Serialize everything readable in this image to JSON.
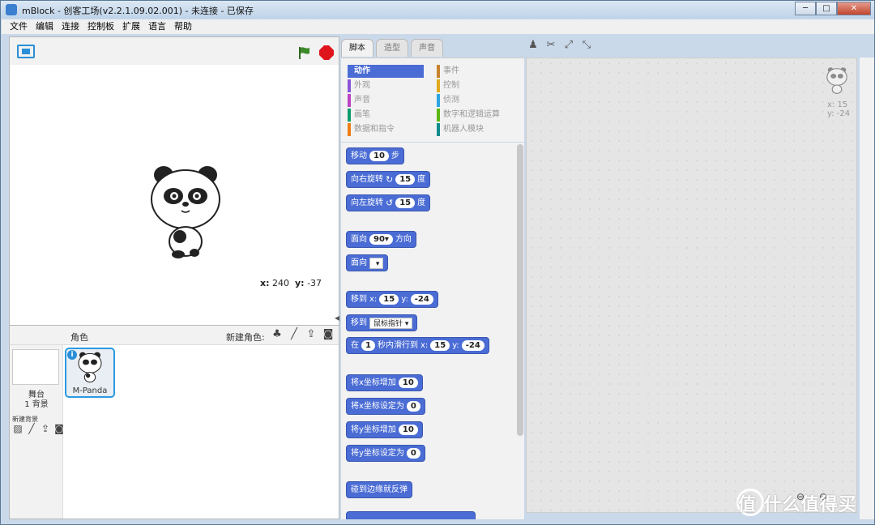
{
  "window": {
    "title": "mBlock - 创客工场(v2.2.1.09.02.001) - 未连接 - 已保存",
    "controls": [
      "─",
      "□",
      "✕"
    ]
  },
  "menu": [
    "文件",
    "编辑",
    "连接",
    "控制板",
    "扩展",
    "语言",
    "帮助"
  ],
  "stage": {
    "coord_x_label": "x:",
    "coord_x": "240",
    "coord_y_label": "y:",
    "coord_y": "-37"
  },
  "sprites": {
    "title": "角色",
    "new_sprite_label": "新建角色:",
    "stage_label": "舞台",
    "background_count": "1 背景",
    "new_background_label": "新建背景",
    "items": [
      {
        "name": "M-Panda"
      }
    ]
  },
  "tabs": [
    "脚本",
    "造型",
    "声音"
  ],
  "categories": [
    {
      "label": "动作",
      "color": "#4a6cd4"
    },
    {
      "label": "外观",
      "color": "#8a55d7"
    },
    {
      "label": "声音",
      "color": "#bb42c3"
    },
    {
      "label": "画笔",
      "color": "#0e9a6c"
    },
    {
      "label": "数据和指令",
      "color": "#ee7d16"
    },
    {
      "label": "事件",
      "color": "#c88330"
    },
    {
      "label": "控制",
      "color": "#e1a91a"
    },
    {
      "label": "侦测",
      "color": "#2ca5e2"
    },
    {
      "label": "数字和逻辑运算",
      "color": "#5cb712"
    },
    {
      "label": "机器人模块",
      "color": "#0f8c8c"
    }
  ],
  "blocks": {
    "move": {
      "a": "移动",
      "v": "10",
      "b": "步"
    },
    "turn_right": {
      "a": "向右旋转",
      "v": "15",
      "b": "度"
    },
    "turn_left": {
      "a": "向左旋转",
      "v": "15",
      "b": "度"
    },
    "point_dir": {
      "a": "面向",
      "v": "90▾",
      "b": "方向"
    },
    "point_towards": {
      "a": "面向"
    },
    "goto_xy": {
      "a": "移到",
      "xl": "x:",
      "x": "15",
      "yl": "y:",
      "y": "-24"
    },
    "goto_target": {
      "a": "移到",
      "v": "鼠标指针"
    },
    "glide": {
      "a": "在",
      "t": "1",
      "b": "秒内滑行到",
      "xl": "x:",
      "x": "15",
      "yl": "y:",
      "y": "-24"
    },
    "change_x": {
      "a": "将x坐标增加",
      "v": "10"
    },
    "set_x": {
      "a": "将x坐标设定为",
      "v": "0"
    },
    "change_y": {
      "a": "将y坐标增加",
      "v": "10"
    },
    "set_y": {
      "a": "将y坐标设定为",
      "v": "0"
    },
    "bounce": {
      "a": "碰到边缘就反弹"
    }
  },
  "script_area": {
    "x_label": "x: 15",
    "y_label": "y: -24"
  },
  "watermark": "值 什么值得买"
}
